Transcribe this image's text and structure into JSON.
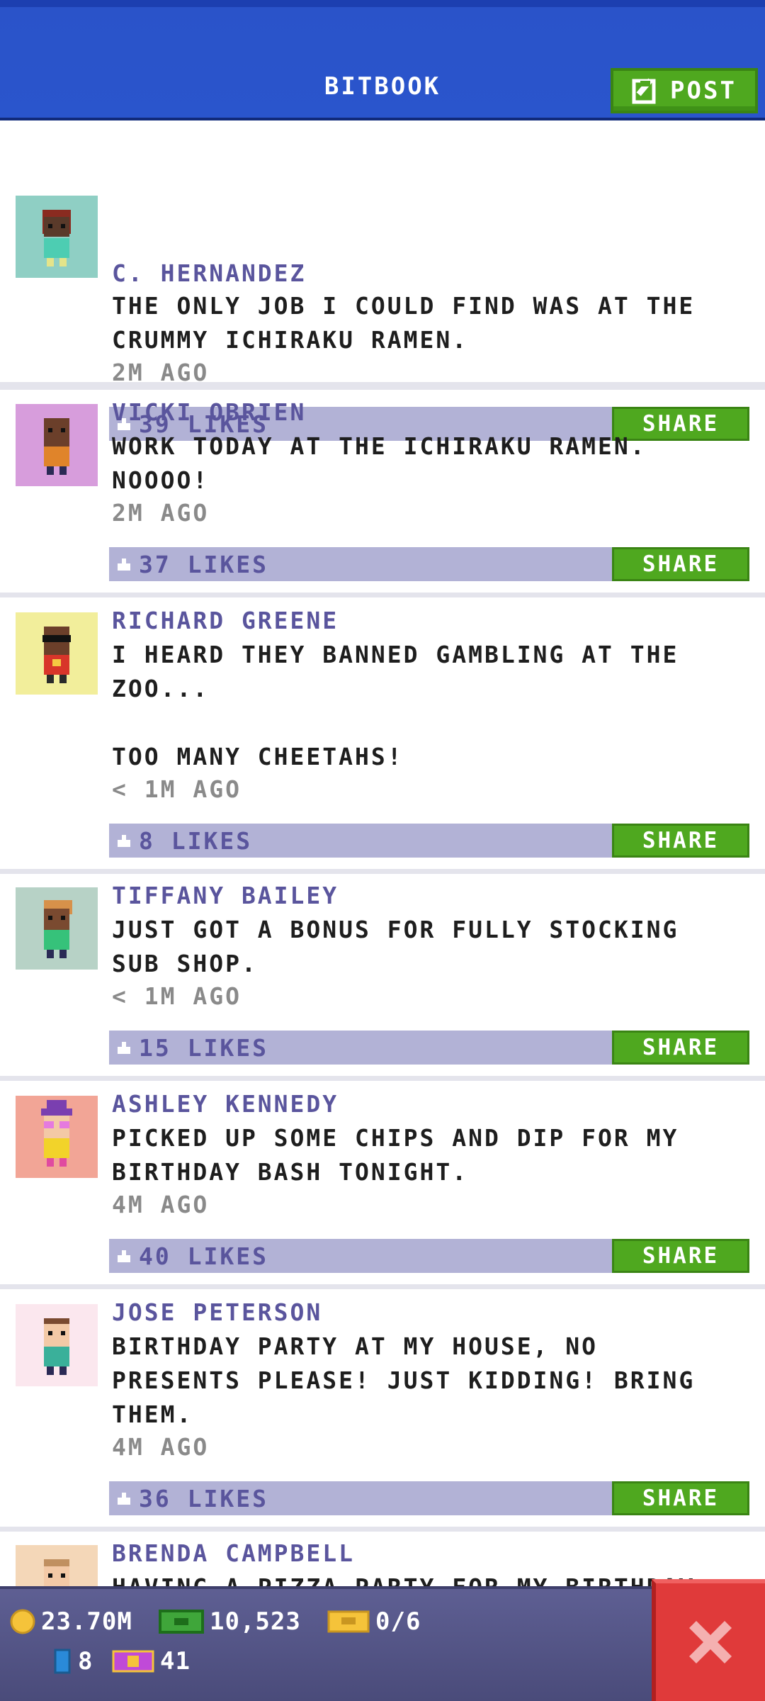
{
  "header": {
    "title": "BITBOOK",
    "post_label": "POST"
  },
  "posts": [
    {
      "name": "C. HERNANDEZ",
      "message": "THE ONLY JOB I COULD FIND WAS AT THE\nCRUMMY ICHIRAKU RAMEN.",
      "time": "2M AGO",
      "likes": "39 LIKES",
      "share": "SHARE",
      "avatar_bg": "#8fcfc4"
    },
    {
      "name": "VICKI OBRIEN",
      "message": "WORK TODAY AT THE ICHIRAKU RAMEN.\nNOOOO!",
      "time": "2M AGO",
      "likes": "37 LIKES",
      "share": "SHARE",
      "avatar_bg": "#d79ddc"
    },
    {
      "name": "RICHARD GREENE",
      "message": "I HEARD THEY BANNED GAMBLING AT THE\nZOO...\n\nTOO MANY CHEETAHS!",
      "time": "< 1M AGO",
      "likes": "8 LIKES",
      "share": "SHARE",
      "avatar_bg": "#f2ee9b"
    },
    {
      "name": "TIFFANY BAILEY",
      "message": "JUST GOT A BONUS FOR FULLY STOCKING\nSUB SHOP.",
      "time": "< 1M AGO",
      "likes": "15 LIKES",
      "share": "SHARE",
      "avatar_bg": "#b7d2c6"
    },
    {
      "name": "ASHLEY KENNEDY",
      "message": "PICKED UP SOME CHIPS AND DIP FOR MY\nBIRTHDAY BASH TONIGHT.",
      "time": "4M AGO",
      "likes": "40 LIKES",
      "share": "SHARE",
      "avatar_bg": "#f2a596"
    },
    {
      "name": "JOSE PETERSON",
      "message": "BIRTHDAY PARTY AT MY HOUSE, NO\nPRESENTS PLEASE! JUST KIDDING! BRING\nTHEM.",
      "time": "4M AGO",
      "likes": "36 LIKES",
      "share": "SHARE",
      "avatar_bg": "#fbe7ee"
    },
    {
      "name": "BRENDA CAMPBELL",
      "message": "HAVING A PIZZA PARTY FOR MY BIRTHDAY",
      "time": "",
      "likes": "",
      "share": "",
      "avatar_bg": "#f4d7b8"
    }
  ],
  "bottom_bar": {
    "coins": "23.70M",
    "bux": "10,523",
    "tickets": "0/6",
    "vip": "8",
    "gifts": "41"
  },
  "colors": {
    "accent_blue": "#2a55cc",
    "share_green": "#4fa81f",
    "likes_bar": "#b2b2d6",
    "close_red": "#e03a3a"
  }
}
